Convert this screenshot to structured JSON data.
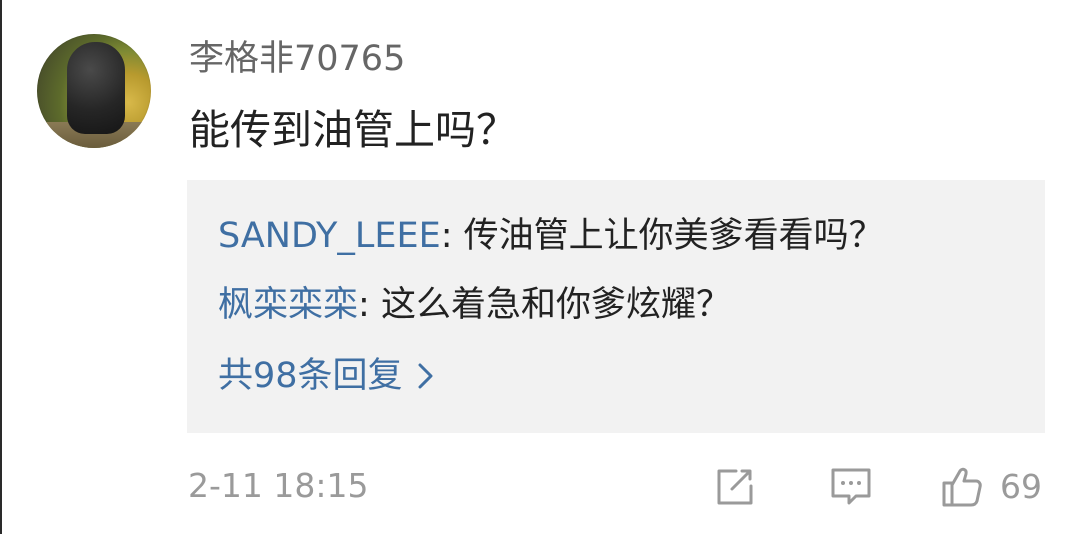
{
  "comment": {
    "username": "李格非70765",
    "text": "能传到油管上吗？",
    "timestamp": "2-11 18:15",
    "like_count": "69"
  },
  "replies": [
    {
      "user": "SANDY_LEEE",
      "separator": ": ",
      "text": "传油管上让你美爹看看吗？"
    },
    {
      "user": "枫栾栾栾",
      "separator": ": ",
      "text": "这么着急和你爹炫耀？"
    }
  ],
  "more_replies": {
    "label": "共98条回复"
  },
  "icons": {
    "share": "share-icon",
    "comment": "comment-icon",
    "like": "thumbs-up-icon",
    "chevron": "chevron-right-icon"
  },
  "colors": {
    "link_blue": "#3f6fa3",
    "muted_gray": "#9a9a9a",
    "reply_bg": "#f2f2f2"
  }
}
